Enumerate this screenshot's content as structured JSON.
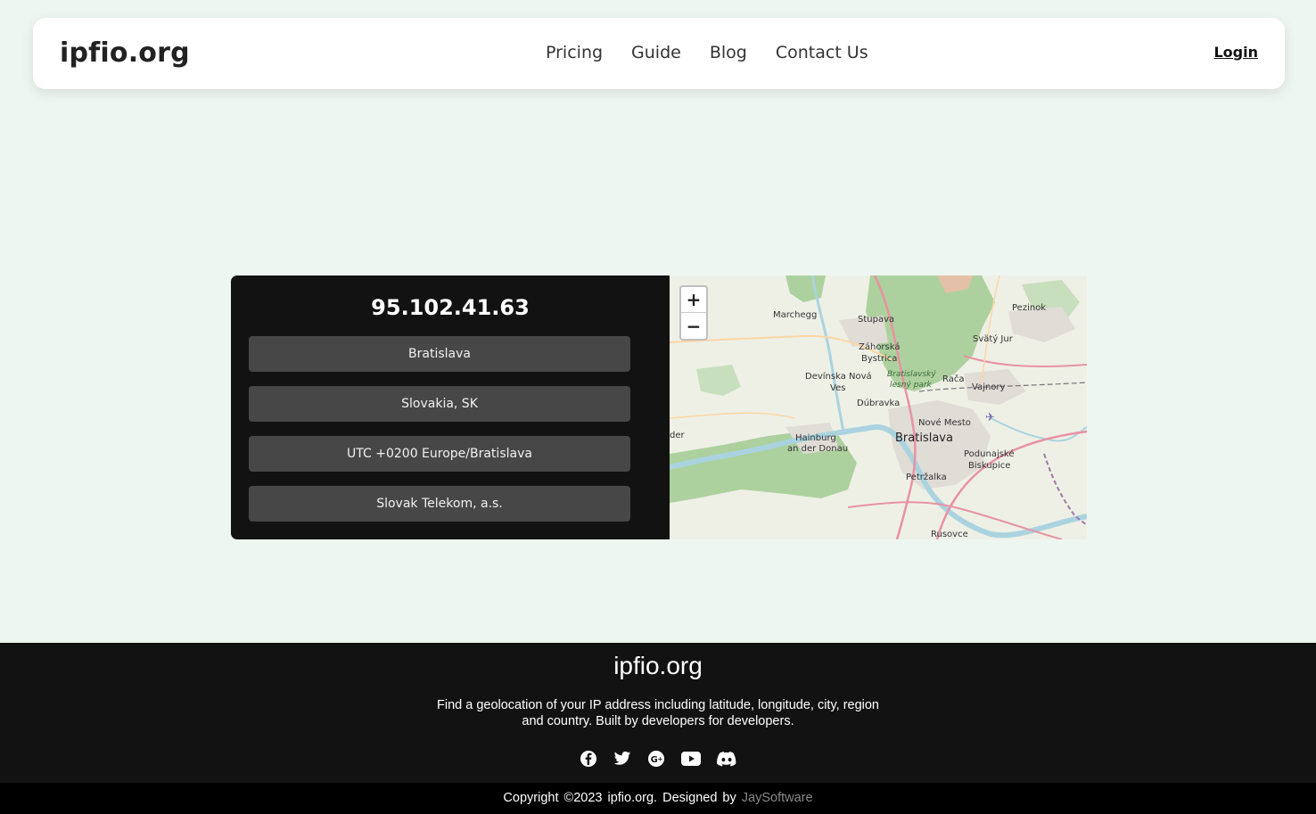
{
  "header": {
    "brand": "ipfio.org",
    "nav": [
      "Pricing",
      "Guide",
      "Blog",
      "Contact Us"
    ],
    "login": "Login"
  },
  "lookup": {
    "ip": "95.102.41.63",
    "city": "Bratislava",
    "country": "Slovakia, SK",
    "timezone": "UTC +0200 Europe/Bratislava",
    "isp": "Slovak Telekom, a.s."
  },
  "map": {
    "zoom_in": "+",
    "zoom_out": "−",
    "labels": {
      "marchegg": "Marchegg",
      "stupava": "Stupava",
      "pezinok": "Pezinok",
      "svaty_jur": "Svätý Jur",
      "zahorska_1": "Záhorská",
      "zahorska_2": "Bystrica",
      "bratislavsky_1": "Bratislavský",
      "bratislavsky_2": "lesný park",
      "devinska_1": "Devínska Nová",
      "devinska_2": "Ves",
      "raca": "Rača",
      "vajnory": "Vajnory",
      "dubravka": "Dúbravka",
      "nove_mesto": "Nové Mesto",
      "bratislava": "Bratislava",
      "hainburg_1": "Hainburg",
      "hainburg_2": "an der Donau",
      "podunajske_1": "Podunajské",
      "podunajske_2": "Biskupice",
      "petrzalka": "Petržalka",
      "rusovce": "Rusovce",
      "edge": "der"
    }
  },
  "footer": {
    "brand": "ipfio.org",
    "description": "Find a geolocation of your IP address including latitude, longitude, city, region and country. Built by developers for developers.",
    "socials": [
      "facebook-icon",
      "twitter-icon",
      "google-plus-icon",
      "youtube-icon",
      "discord-icon"
    ],
    "copyright": "Copyright ©2023 ipfio.org. Designed by",
    "designer": "JaySoftware"
  }
}
